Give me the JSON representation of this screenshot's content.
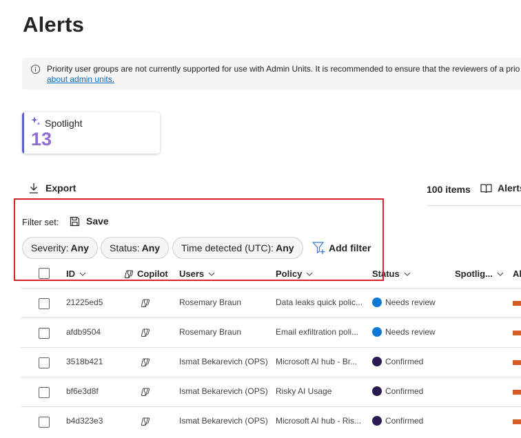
{
  "page": {
    "title": "Alerts"
  },
  "banner": {
    "icon": "info-icon",
    "text": "Priority user groups are not currently supported for use with Admin Units. It is recommended to ensure that the reviewers of a prio",
    "link": "about admin units."
  },
  "spotlight": {
    "icon": "sparkle-icon",
    "label": "Spotlight",
    "count": "13",
    "accent_color": "#5b5fc7",
    "count_color": "#8f6bd6"
  },
  "toolbar": {
    "export_label": "Export",
    "items_count": "100 items",
    "alerts_link": "Alerts"
  },
  "filters": {
    "filter_set_label": "Filter set:",
    "save_label": "Save",
    "pills": [
      {
        "key": "Severity:",
        "value": "Any"
      },
      {
        "key": "Status:",
        "value": "Any"
      },
      {
        "key": "Time detected (UTC):",
        "value": "Any"
      }
    ],
    "add_filter_label": "Add filter"
  },
  "table": {
    "columns": [
      "ID",
      "Copilot",
      "Users",
      "Policy",
      "Status",
      "Spotlig...",
      "Al"
    ],
    "rows": [
      {
        "id": "21225ed5",
        "user": "Rosemary Braun",
        "policy": "Data leaks quick polic...",
        "status": "Needs review",
        "status_color": "#0f78d4"
      },
      {
        "id": "afdb9504",
        "user": "Rosemary Braun",
        "policy": "Email exfiltration poli...",
        "status": "Needs review",
        "status_color": "#0f78d4"
      },
      {
        "id": "3518b421",
        "user": "Ismat Bekarevich (OPS)",
        "policy": "Microsoft AI hub - Br...",
        "status": "Confirmed",
        "status_color": "#2b1a52"
      },
      {
        "id": "bf6e3d8f",
        "user": "Ismat Bekarevich (OPS)",
        "policy": "Risky AI Usage",
        "status": "Confirmed",
        "status_color": "#2b1a52"
      },
      {
        "id": "b4d323e3",
        "user": "Ismat Bekarevich (OPS)",
        "policy": "Microsoft AI hub - Ris...",
        "status": "Confirmed",
        "status_color": "#2b1a52"
      }
    ]
  },
  "colors": {
    "highlight": "#d9242b",
    "severity": "#d65b26"
  }
}
